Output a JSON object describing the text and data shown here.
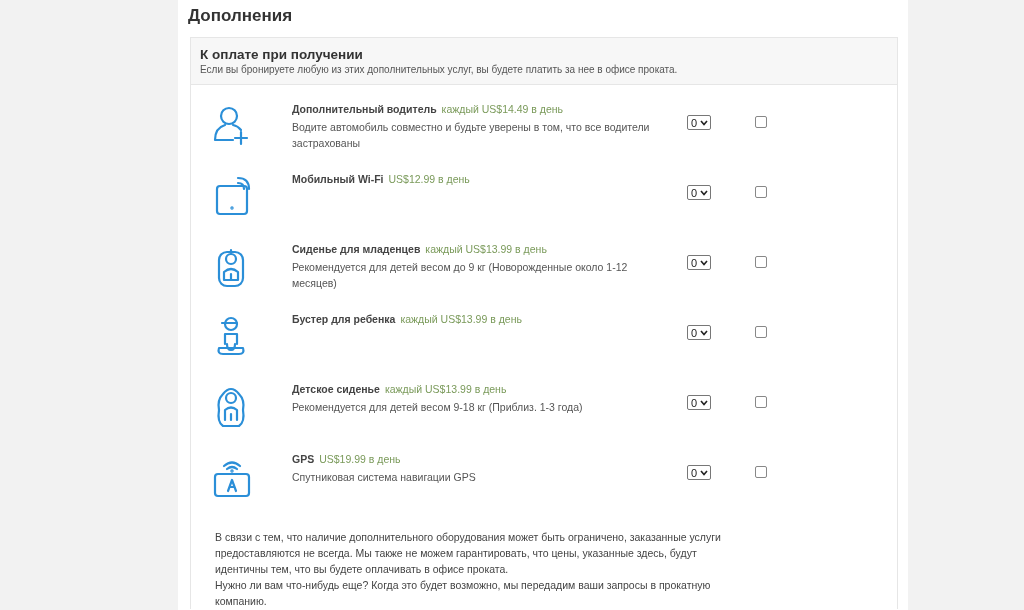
{
  "title": "Дополнения",
  "panel": {
    "title": "К оплате при получении",
    "subtitle": "Если вы бронируете любую из этих дополнительных услуг, вы будете платить за нее в офисе проката.",
    "items": [
      {
        "kind": "driver",
        "name": "Дополнительный водитель",
        "price": "каждый US$14.49 в день",
        "description": "Водите автомобиль совместно и будьте уверены в том, что все водители застрахованы",
        "quantity": "0",
        "checked": false
      },
      {
        "kind": "wifi",
        "name": "Мобильный Wi-Fi",
        "price": "US$12.99 в день",
        "quantity": "0",
        "checked": false
      },
      {
        "kind": "infant",
        "name": "Сиденье для младенцев",
        "price": "каждый US$13.99 в день",
        "description": "Рекомендуется для детей весом до 9 кг (Новорожденные около 1-12 месяцев)",
        "quantity": "0",
        "checked": false
      },
      {
        "kind": "booster",
        "name": "Бустер для ребенка",
        "price": "каждый US$13.99 в день",
        "quantity": "0",
        "checked": false
      },
      {
        "kind": "child",
        "name": "Детское сиденье",
        "price": "каждый US$13.99 в день",
        "description": "Рекомендуется для детей весом 9-18 кг (Приблиз. 1-3 года)",
        "quantity": "0",
        "checked": false
      },
      {
        "kind": "gps",
        "name": "GPS",
        "price": "US$19.99 в день",
        "description": "Спутниковая система навигации GPS",
        "quantity": "0",
        "checked": false
      }
    ],
    "notes": [
      "В связи с тем, что наличие дополнительного оборудования может быть ограничено, заказанные услуги предоставляются не всегда. Мы также не можем гарантировать, что цены, указанные здесь, будут идентичны тем, что вы будете оплачивать в офисе проката.",
      "Нужно ли вам что-нибудь еще? Когда это будет возможно, мы передадим ваши запросы в прокатную компанию."
    ]
  }
}
